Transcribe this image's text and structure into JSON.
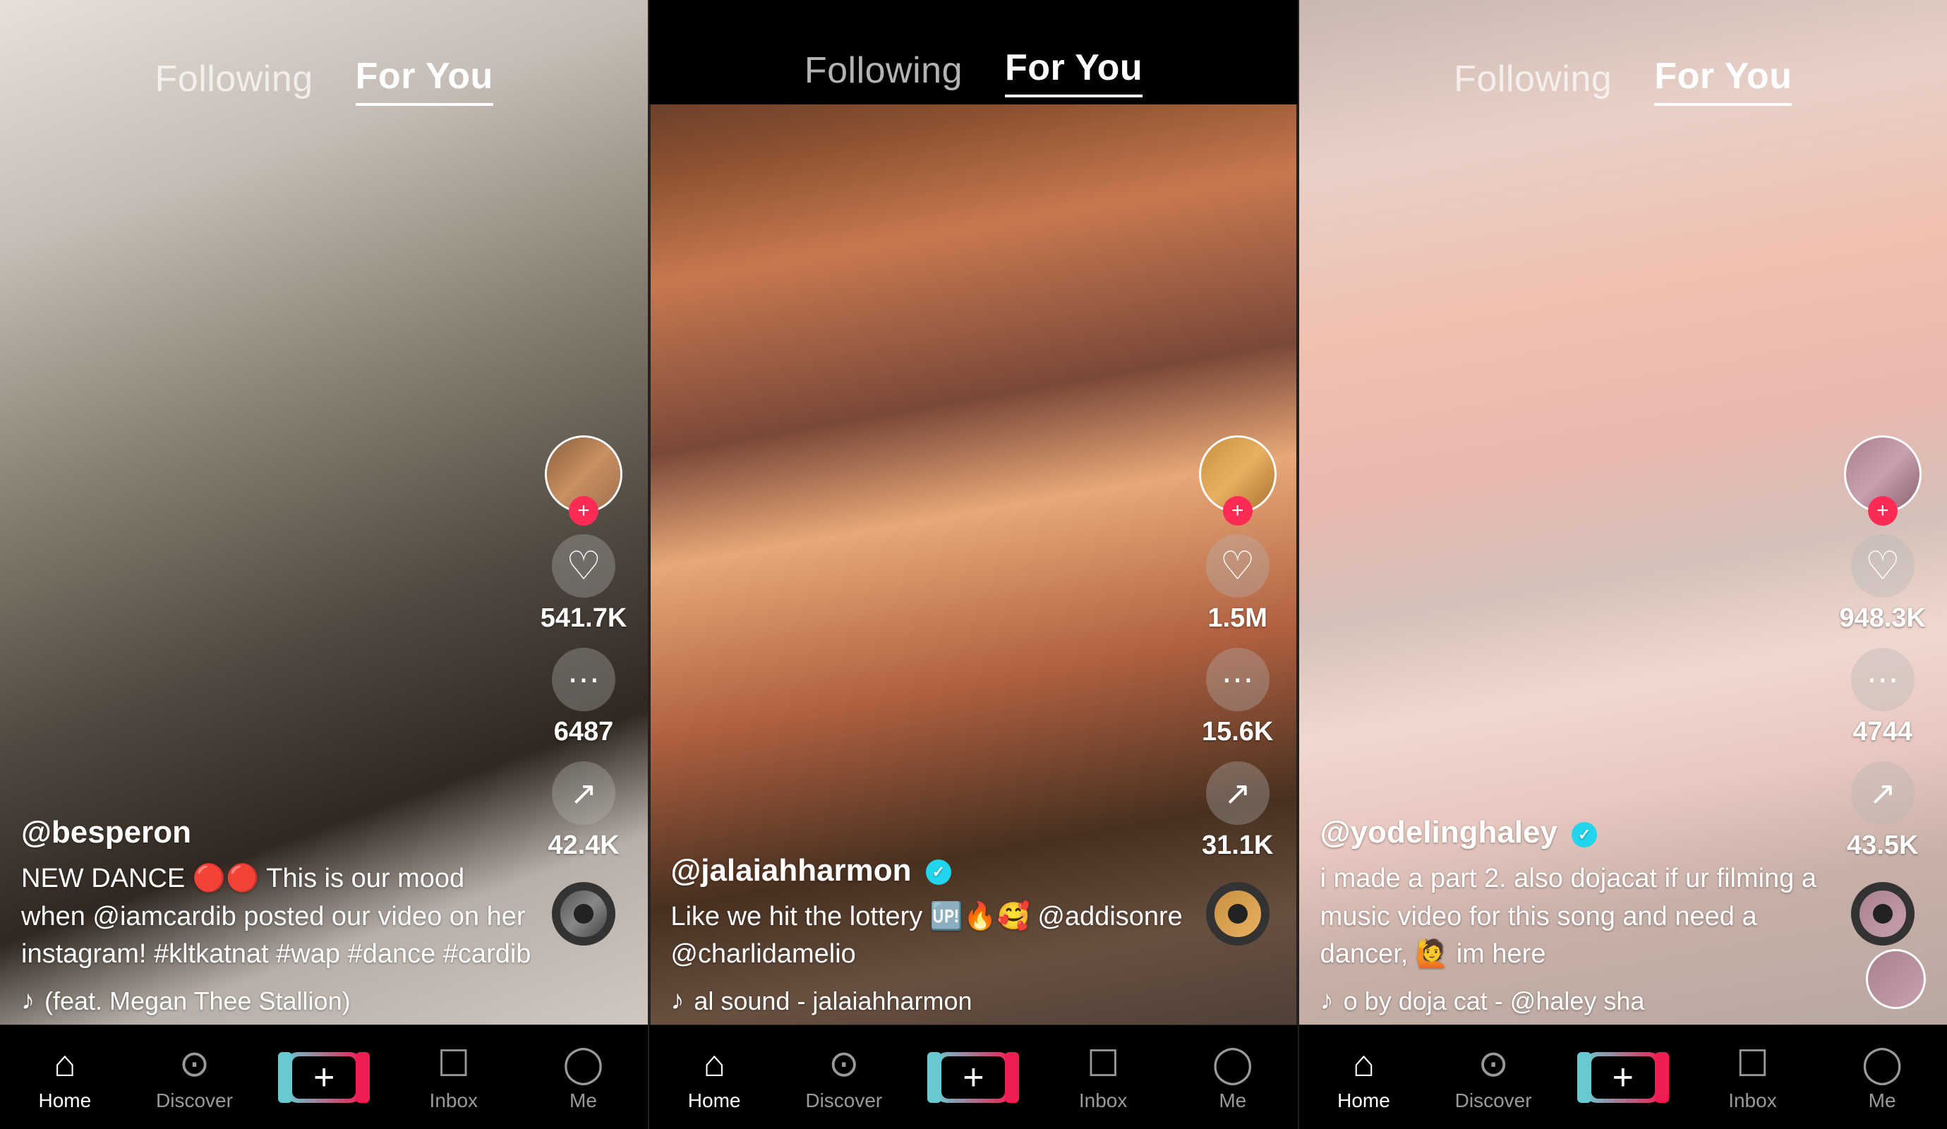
{
  "phones": [
    {
      "id": "phone-1",
      "header": {
        "following": "Following",
        "for_you": "For You",
        "active": "for_you"
      },
      "username": "@besperon",
      "caption": "NEW DANCE 🔴🔴 This is our mood when @iamcardib posted our video on her instagram! #kltkatnat #wap #dance #cardib",
      "music": "♪ (feat. Megan Thee Stallion)",
      "likes": "541.7K",
      "comments": "6487",
      "shares": "42.4K",
      "nav": {
        "home": "Home",
        "discover": "Discover",
        "inbox": "Inbox",
        "me": "Me"
      }
    },
    {
      "id": "phone-2",
      "header": {
        "following": "Following",
        "for_you": "For You",
        "active": "for_you"
      },
      "username": "@jalaiahharmon",
      "verified": true,
      "caption": "Like we hit the lottery 🆙🔥🥰 @addisonre @charlidamelio",
      "music": "♪ al sound - jalaiahharmon",
      "likes": "1.5M",
      "comments": "15.6K",
      "shares": "31.1K",
      "nav": {
        "home": "Home",
        "discover": "Discover",
        "inbox": "Inbox",
        "me": "Me"
      }
    },
    {
      "id": "phone-3",
      "header": {
        "following": "Following",
        "for_you": "For You",
        "active": "for_you"
      },
      "username": "@yodelinghaley",
      "verified": true,
      "caption": "i made a part 2. also dojacat if ur filming a music video for this song and need a dancer, 🙋 im here",
      "music": "♪ o by doja cat - @haley sha",
      "likes": "948.3K",
      "comments": "4744",
      "shares": "43.5K",
      "nav": {
        "home": "Home",
        "discover": "Discover",
        "inbox": "Inbox",
        "me": "Me"
      }
    }
  ]
}
